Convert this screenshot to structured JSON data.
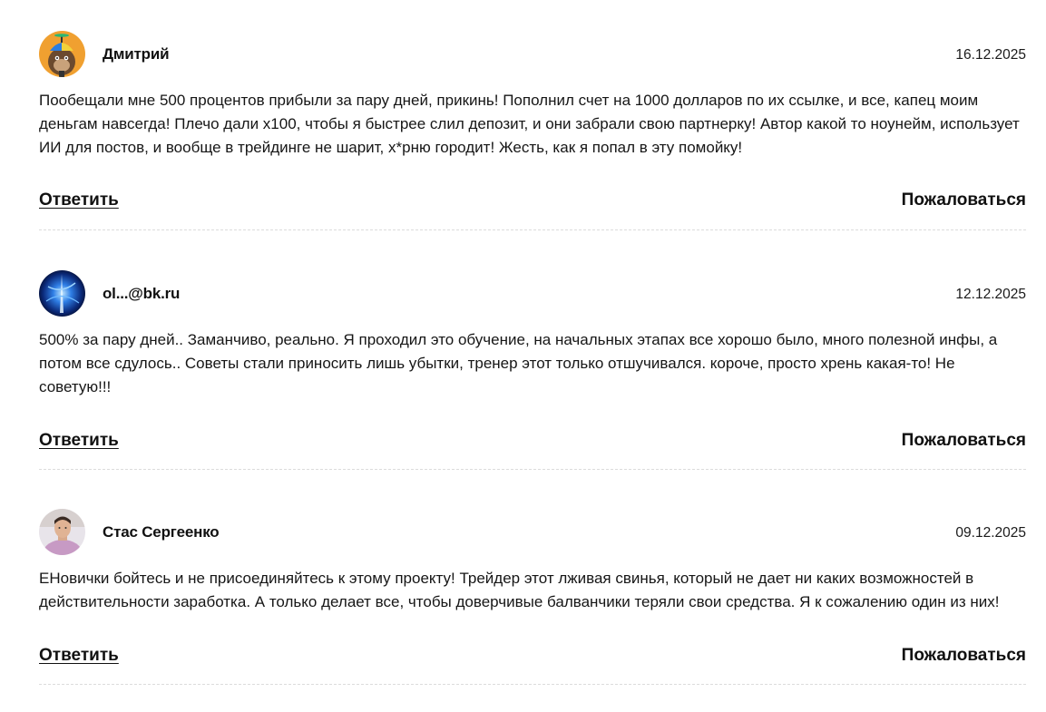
{
  "comments": [
    {
      "author": "Дмитрий",
      "date": "16.12.2025",
      "avatar_icon": "cartoon-ape-with-propeller-cap-icon",
      "text": "Пообещали мне 500 процентов прибыли за пару дней, прикинь! Пополнил счет на 1000 долларов по их ссылке, и все, капец моим деньгам навсегда! Плечо дали х100, чтобы я быстрее слил депозит, и они забрали свою партнерку! Автор какой то ноунейм, использует ИИ для постов, и вообще в трейдинге не шарит, х*рню городит! Жесть, как я попал в эту помойку!",
      "reply_label": "Ответить",
      "report_label": "Пожаловаться"
    },
    {
      "author": "ol...@bk.ru",
      "date": "12.12.2025",
      "avatar_icon": "blue-light-abstract-avatar-icon",
      "text": "500% за пару дней.. Заманчиво, реально. Я проходил это обучение, на начальных этапах все хорошо было, много полезной инфы, а потом все сдулось.. Советы стали приносить лишь убытки, тренер этот только отшучивался. короче, просто хрень какая-то! Не советую!!!",
      "reply_label": "Ответить",
      "report_label": "Пожаловаться"
    },
    {
      "author": "Стас Сергеенко",
      "date": "09.12.2025",
      "avatar_icon": "user-photo-avatar-icon",
      "text": "ЕНовички бойтесь и не присоединяйтесь к этому проекту! Трейдер этот лживая свинья, который не дает ни каких возможностей в действительности заработка. А только делает все, чтобы доверчивые балванчики теряли свои средства. Я к сожалению один из них!",
      "reply_label": "Ответить",
      "report_label": "Пожаловаться"
    }
  ]
}
